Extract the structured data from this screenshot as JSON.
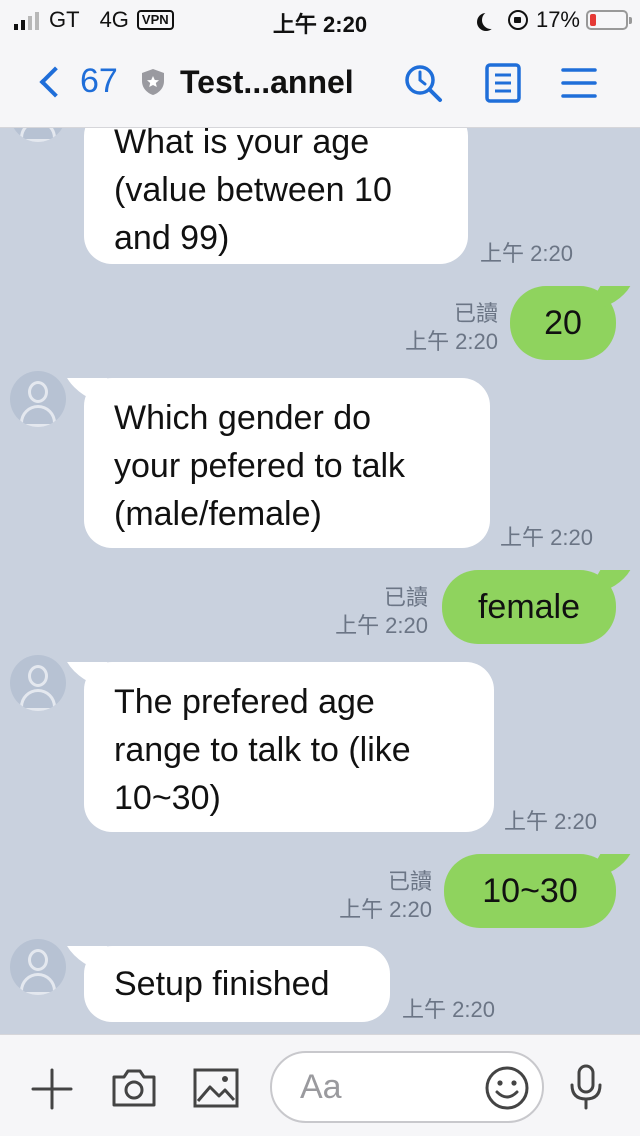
{
  "status_bar": {
    "carrier": "GT",
    "network": "4G",
    "vpn": "VPN",
    "time": "上午 2:20",
    "battery": "17%",
    "battery_level": 0.17
  },
  "header": {
    "back_count": "67",
    "title": "Test...annel"
  },
  "messages": [
    {
      "side": "in",
      "text": "What is your age\n(value between 10\nand 99)",
      "time": "上午 2:20"
    },
    {
      "side": "out",
      "text": "20",
      "read": "已讀",
      "time": "上午 2:20"
    },
    {
      "side": "in",
      "text": "Which gender do\nyour pefered to talk\n(male/female)",
      "time": "上午 2:20"
    },
    {
      "side": "out",
      "text": "female",
      "read": "已讀",
      "time": "上午 2:20"
    },
    {
      "side": "in",
      "text": "The prefered age\nrange to talk to (like\n10~30)",
      "time": "上午 2:20"
    },
    {
      "side": "out",
      "text": "10~30",
      "read": "已讀",
      "time": "上午 2:20"
    },
    {
      "side": "in",
      "text": "Setup finished",
      "time": "上午 2:20"
    }
  ],
  "input": {
    "placeholder": "Aa"
  },
  "colors": {
    "accent": "#1f6ed9",
    "outgoing_bubble": "#8fd35e",
    "chat_background": "#c9d1de"
  }
}
